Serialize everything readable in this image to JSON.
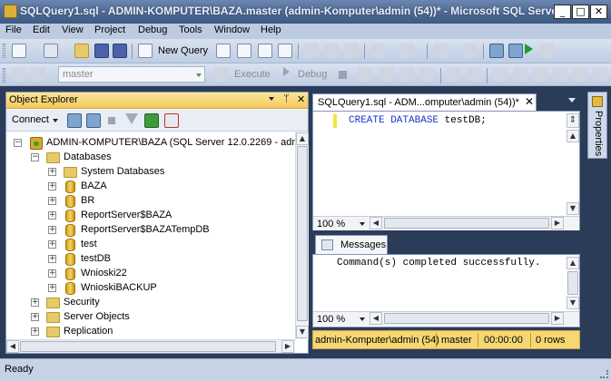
{
  "window": {
    "title": "SQLQuery1.sql - ADMIN-KOMPUTER\\BAZA.master (admin-Komputer\\admin (54))* - Microsoft SQL Serve...",
    "minimize": "_",
    "maximize": "□",
    "close": "✕"
  },
  "menu": [
    "File",
    "Edit",
    "View",
    "Project",
    "Debug",
    "Tools",
    "Window",
    "Help"
  ],
  "toolbar1": {
    "new_query_label": "New Query",
    "icons": [
      "new-project-icon",
      "add-item-icon",
      "open-file-icon",
      "save-icon",
      "save-all-icon",
      "new-query-icon",
      "database-engine-query-icon",
      "analysis-services-query-icon",
      "xmla-query-icon",
      "dmx-query-icon",
      "cut-icon",
      "copy-icon",
      "paste-icon",
      "undo-icon",
      "redo-icon",
      "navigate-icon",
      "activity-monitor-icon",
      "registered-servers-icon",
      "object-explorer-icon",
      "start-icon"
    ]
  },
  "toolbar2": {
    "database_value": "master",
    "execute_label": "Execute",
    "debug_label": "Debug"
  },
  "object_explorer": {
    "title": "Object Explorer",
    "pin": "ᛘ",
    "close": "✕",
    "connect_label": "Connect",
    "tree": {
      "server": "ADMIN-KOMPUTER\\BAZA (SQL Server 12.0.2269 - admin",
      "databases": "Databases",
      "system_databases": "System Databases",
      "db_items": [
        "BAZA",
        "BR",
        "ReportServer$BAZA",
        "ReportServer$BAZATempDB",
        "test",
        "testDB",
        "Wnioski22",
        "WnioskiBACKUP"
      ],
      "security": "Security",
      "server_objects": "Server Objects",
      "replication": "Replication"
    }
  },
  "query": {
    "tab_label": "SQLQuery1.sql - ADM...omputer\\admin (54))*",
    "tab_close": "✕",
    "code_keyword": "CREATE DATABASE",
    "code_rest": " testDB;",
    "editor_zoom": "100 %",
    "messages_tab": "Messages",
    "message_text": "Command(s) completed successfully.",
    "messages_zoom": "100 %"
  },
  "query_status": {
    "user": "admin-Komputer\\admin (54)",
    "database": "master",
    "elapsed": "00:00:00",
    "rows": "0 rows"
  },
  "properties_tab": "Properties",
  "status_bar": "Ready"
}
